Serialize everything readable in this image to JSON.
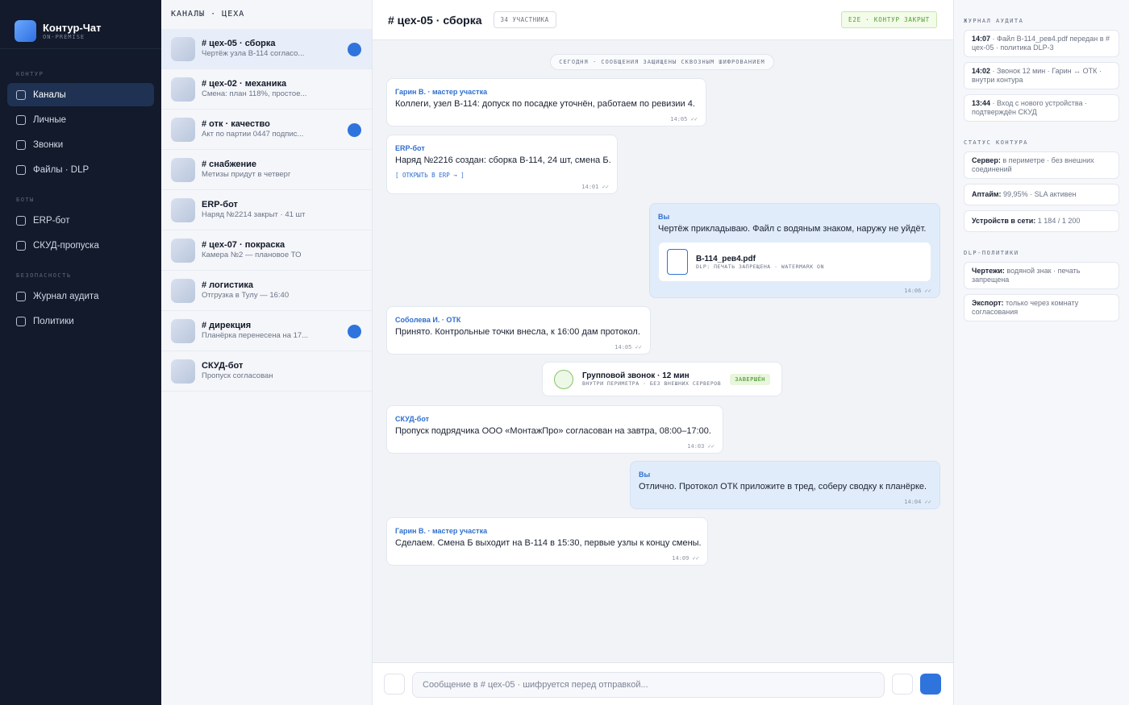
{
  "app": {
    "title": "Контур-Чат",
    "subtitle": "ON-PREMISE"
  },
  "nav": {
    "sections": [
      {
        "title": "КОНТУР",
        "items": [
          {
            "label": "Каналы",
            "active": true
          },
          {
            "label": "Личные",
            "active": false
          },
          {
            "label": "Звонки",
            "active": false
          },
          {
            "label": "Файлы · DLP",
            "active": false
          }
        ]
      },
      {
        "title": "БОТЫ",
        "items": [
          {
            "label": "ERP-бот",
            "active": false
          },
          {
            "label": "СКУД-пропуска",
            "active": false
          }
        ]
      },
      {
        "title": "БЕЗОПАСНОСТЬ",
        "items": [
          {
            "label": "Журнал аудита",
            "active": false
          },
          {
            "label": "Политики",
            "active": false
          }
        ]
      }
    ]
  },
  "channels": {
    "header": "КАНАЛЫ · ЦЕХА",
    "items": [
      {
        "name": "# цех-05 · сборка",
        "preview": "Чертёж узла В-114 согласо...",
        "unread": true,
        "active": true
      },
      {
        "name": "# цех-02 · механика",
        "preview": "Смена: план 118%, простое...",
        "unread": false,
        "active": false
      },
      {
        "name": "# отк · качество",
        "preview": "Акт по партии 0447 подпис...",
        "unread": true,
        "active": false
      },
      {
        "name": "# снабжение",
        "preview": "Метизы придут в четверг",
        "unread": false,
        "active": false
      },
      {
        "name": "ERP-бот",
        "preview": "Наряд №2214 закрыт · 41 шт",
        "unread": false,
        "active": false
      },
      {
        "name": "# цех-07 · покраска",
        "preview": "Камера №2 — плановое ТО",
        "unread": false,
        "active": false
      },
      {
        "name": "# логистика",
        "preview": "Отгрузка в Тулу — 16:40",
        "unread": false,
        "active": false
      },
      {
        "name": "# дирекция",
        "preview": "Планёрка перенесена на 17...",
        "unread": true,
        "active": false
      },
      {
        "name": "СКУД-бот",
        "preview": "Пропуск согласован",
        "unread": false,
        "active": false
      }
    ]
  },
  "chat": {
    "title": "# цех-05 · сборка",
    "members": "34 УЧАСТНИКА",
    "security": "E2E · КОНТУР ЗАКРЫТ",
    "day_separator": "СЕГОДНЯ · СООБЩЕНИЯ ЗАЩИЩЕНЫ СКВОЗНЫМ ШИФРОВАНИЕМ",
    "messages": [
      {
        "author": "Гарин В. · мастер участка",
        "text": "Коллеги, узел В-114: допуск по посадке уточнён, работаем по ревизии 4.",
        "time": "14:05 ✓✓",
        "mine": false
      },
      {
        "author": "ERP-бот",
        "text": "Наряд №2216 создан: сборка В-114, 24 шт, смена Б.",
        "link": "[ ОТКРЫТЬ В ERP → ]",
        "time": "14:01 ✓✓",
        "mine": false
      },
      {
        "author": "Вы",
        "text": "Чертёж прикладываю. Файл с водяным знаком, наружу не уйдёт.",
        "time": "14:06 ✓✓",
        "mine": true,
        "attachment": {
          "name": "В-114_рев4.pdf",
          "meta": "DLP: ПЕЧАТЬ ЗАПРЕЩЕНА · WATERMARK ON"
        }
      },
      {
        "author": "Соболева И. · ОТК",
        "text": "Принято. Контрольные точки внесла, к 16:00 дам протокол.",
        "time": "14:05 ✓✓",
        "mine": false
      },
      {
        "author": "СКУД-бот",
        "text": "Пропуск подрядчика ООО «МонтажПро» согласован на завтра, 08:00–17:00.",
        "time": "14:03 ✓✓",
        "mine": false
      },
      {
        "author": "Вы",
        "text": "Отлично. Протокол ОТК приложите в тред, соберу сводку к планёрке.",
        "time": "14:04 ✓✓",
        "mine": true
      },
      {
        "author": "Гарин В. · мастер участка",
        "text": "Сделаем. Смена Б выходит на В-114 в 15:30, первые узлы к концу смены.",
        "time": "14:09 ✓✓",
        "mine": false
      }
    ],
    "call": {
      "title": "Групповой звонок · 12 мин",
      "subtitle": "ВНУТРИ ПЕРИМЕТРА · БЕЗ ВНЕШНИХ СЕРВЕРОВ",
      "badge": "ЗАВЕРШЁН"
    },
    "composer": {
      "placeholder": "Сообщение в # цех-05 · шифруется перед отправкой..."
    }
  },
  "side": {
    "audit": {
      "title": "ЖУРНАЛ АУДИТА",
      "items": [
        {
          "key": "14:07",
          "text": " · Файл В-114_рев4.pdf передан в # цех-05 · политика DLP-3"
        },
        {
          "key": "14:02",
          "text": " · Звонок 12 мин · Гарин ↔ ОТК · внутри контура"
        },
        {
          "key": "13:44",
          "text": " · Вход с нового устройства · подтверждён СКУД"
        }
      ]
    },
    "status": {
      "title": "СТАТУС КОНТУРА",
      "items": [
        {
          "key": "Сервер:",
          "text": " в периметре · без внешних соединений"
        },
        {
          "key": "Аптайм:",
          "text": " 99,95% · SLA активен"
        },
        {
          "key": "Устройств в сети:",
          "text": " 1 184 / 1 200"
        }
      ]
    },
    "dlp": {
      "title": "DLP-ПОЛИТИКИ",
      "items": [
        {
          "key": "Чертежи:",
          "text": " водяной знак · печать запрещена"
        },
        {
          "key": "Экспорт:",
          "text": " только через комнату согласования"
        }
      ]
    }
  }
}
